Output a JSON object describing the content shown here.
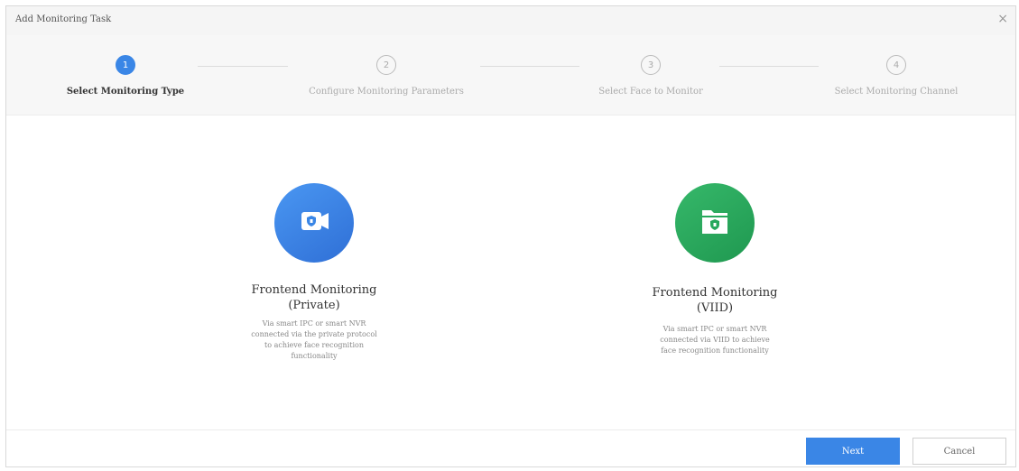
{
  "dialog": {
    "title": "Add Monitoring Task",
    "close_glyph": "×"
  },
  "steps": [
    {
      "number": "1",
      "label": "Select Monitoring Type",
      "state": "active"
    },
    {
      "number": "2",
      "label": "Configure Monitoring Parameters",
      "state": "inactive"
    },
    {
      "number": "3",
      "label": "Select Face to Monitor",
      "state": "inactive"
    },
    {
      "number": "4",
      "label": "Select Monitoring Channel",
      "state": "inactive"
    }
  ],
  "options": [
    {
      "title_line1": "Frontend Monitoring",
      "title_line2": "(Private)",
      "description": "Via smart IPC or smart NVR connected via the private protocol to achieve face recognition functionality",
      "icon": "camera-icon",
      "color": "#3a86e6"
    },
    {
      "title_line1": "Frontend Monitoring",
      "title_line2": "(VIID)",
      "description": "Via smart IPC or smart NVR connected via VIID to achieve face recognition functionality",
      "icon": "folder-icon",
      "color": "#27a85c"
    }
  ],
  "footer": {
    "next_label": "Next",
    "cancel_label": "Cancel"
  }
}
